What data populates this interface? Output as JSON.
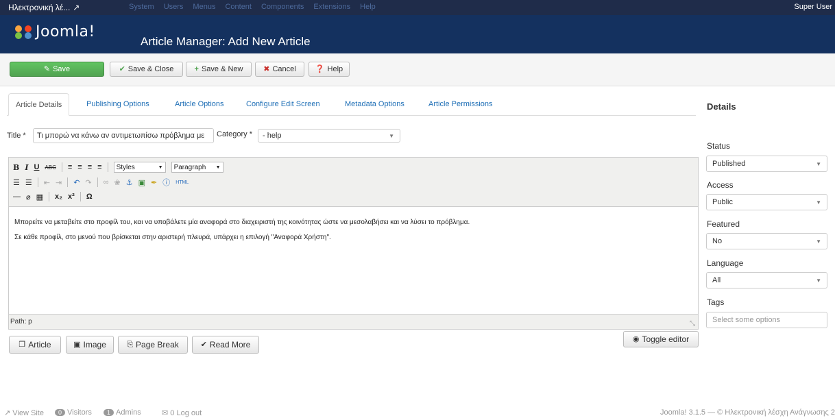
{
  "topbar": {
    "site_name": "Ηλεκτρονική λέ...",
    "menus": [
      "System",
      "Users",
      "Menus",
      "Content",
      "Components",
      "Extensions",
      "Help"
    ],
    "user": "Super User"
  },
  "header": {
    "logo_text": "Joomla!",
    "title": "Article Manager: Add New Article"
  },
  "toolbar": {
    "save": "Save",
    "save_close": "Save & Close",
    "save_new": "Save & New",
    "cancel": "Cancel",
    "help": "Help"
  },
  "tabs": [
    "Article Details",
    "Publishing Options",
    "Article Options",
    "Configure Edit Screen",
    "Metadata Options",
    "Article Permissions"
  ],
  "form": {
    "title_label": "Title *",
    "title_value": "Τι μπορώ να κάνω αν αντιμετωπίσω πρόβλημα με",
    "category_label": "Category *",
    "category_value": "- help"
  },
  "editor": {
    "styles_select": "Styles",
    "format_select": "Paragraph",
    "paragraphs": [
      "Μπορείτε να μεταβείτε στο προφίλ του, και να υποβάλετε μία αναφορά στο διαχειριστή της κοινότητας ώστε να μεσολαβήσει και να λύσει το πρόβλημα.",
      "Σε κάθε προφίλ, στο μενού που βρίσκεται στην αριστερή πλευρά, υπάρχει η επιλογή \"Αναφορά Χρήστη\"."
    ],
    "path": "Path: p"
  },
  "editor_buttons": {
    "article": "Article",
    "image": "Image",
    "page_break": "Page Break",
    "read_more": "Read More",
    "toggle": "Toggle editor"
  },
  "sidebar": {
    "title": "Details",
    "status_label": "Status",
    "status_value": "Published",
    "access_label": "Access",
    "access_value": "Public",
    "featured_label": "Featured",
    "featured_value": "No",
    "language_label": "Language",
    "language_value": "All",
    "tags_label": "Tags",
    "tags_placeholder": "Select some options"
  },
  "footer": {
    "view_site": "View Site",
    "visitors_count": "0",
    "visitors": "Visitors",
    "admins_count": "1",
    "admins": "Admins",
    "logout": "0 Log out",
    "version": "Joomla! 3.1.5 — © Ηλεκτρονική λέσχη Ανάγνωσης 2"
  },
  "colors": {
    "topbar": "#1f2c4a",
    "header": "#14315f",
    "save_green": "#51a351",
    "link_blue": "#1f6fb6"
  }
}
